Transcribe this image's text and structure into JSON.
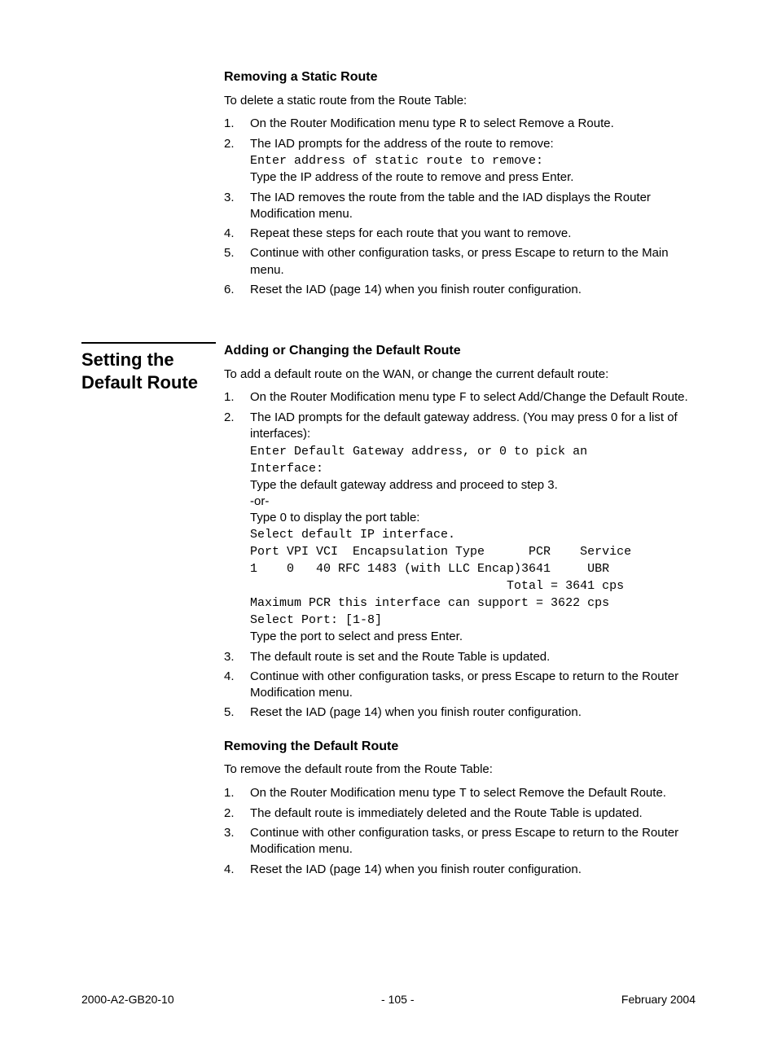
{
  "section1": {
    "heading": "Removing a Static Route",
    "intro": "To delete a static route from the Route Table:",
    "items": [
      {
        "pre": "On the Router Modification menu type ",
        "code": "R",
        "post": " to select Remove a Route."
      },
      {
        "line1": "The IAD prompts for the address of the route to remove:",
        "code": "Enter address of static route to remove:",
        "line2": "Type the IP address of the route to remove and press Enter."
      },
      {
        "text": "The IAD removes the route from the table and the IAD displays the Router Modification menu."
      },
      {
        "text": "Repeat these steps for each route that you want to remove."
      },
      {
        "text": "Continue with other configuration tasks, or press Escape to return to the Main menu."
      },
      {
        "text": "Reset the IAD (page 14) when you finish router configuration."
      }
    ]
  },
  "side_heading": "Setting the Default Route",
  "section2": {
    "heading": "Adding or Changing the Default Route",
    "intro": "To add a default route on the WAN, or change the current default route:",
    "items": [
      {
        "pre": "On the Router Modification menu type ",
        "code": "F",
        "post": " to select Add/Change the Default Route."
      },
      {
        "line1": "The IAD prompts for the default gateway address. (You may press 0 for a list of interfaces):",
        "code1": "Enter Default Gateway address, or 0 to pick an\nInterface:",
        "line2": "Type the default gateway address and proceed to step 3.",
        "or": "-or-",
        "line3": "Type 0 to display the port table:",
        "code2": "Select default IP interface.\nPort VPI VCI  Encapsulation Type      PCR    Service\n1    0   40 RFC 1483 (with LLC Encap)3641     UBR\n                                   Total = 3641 cps\nMaximum PCR this interface can support = 3622 cps\nSelect Port: [1-8]",
        "line4": "Type the port to select and press Enter."
      },
      {
        "text": "The default route is set and the Route Table is updated."
      },
      {
        "text": "Continue with other configuration tasks, or press Escape to return to the Router Modification menu."
      },
      {
        "text": "Reset the IAD (page 14) when you finish router configuration."
      }
    ]
  },
  "section3": {
    "heading": "Removing the Default Route",
    "intro": "To remove the default route from the Route Table:",
    "items": [
      {
        "pre": "On the Router Modification menu type ",
        "code": "T",
        "post": " to select Remove the Default Route."
      },
      {
        "text": "The default route is immediately deleted and the Route Table is updated."
      },
      {
        "text": "Continue with other configuration tasks, or press Escape to return to the Router Modification menu."
      },
      {
        "text": "Reset the IAD (page 14) when you finish router configuration."
      }
    ]
  },
  "footer": {
    "left": "2000-A2-GB20-10",
    "center": "- 105 -",
    "right": "February 2004"
  }
}
